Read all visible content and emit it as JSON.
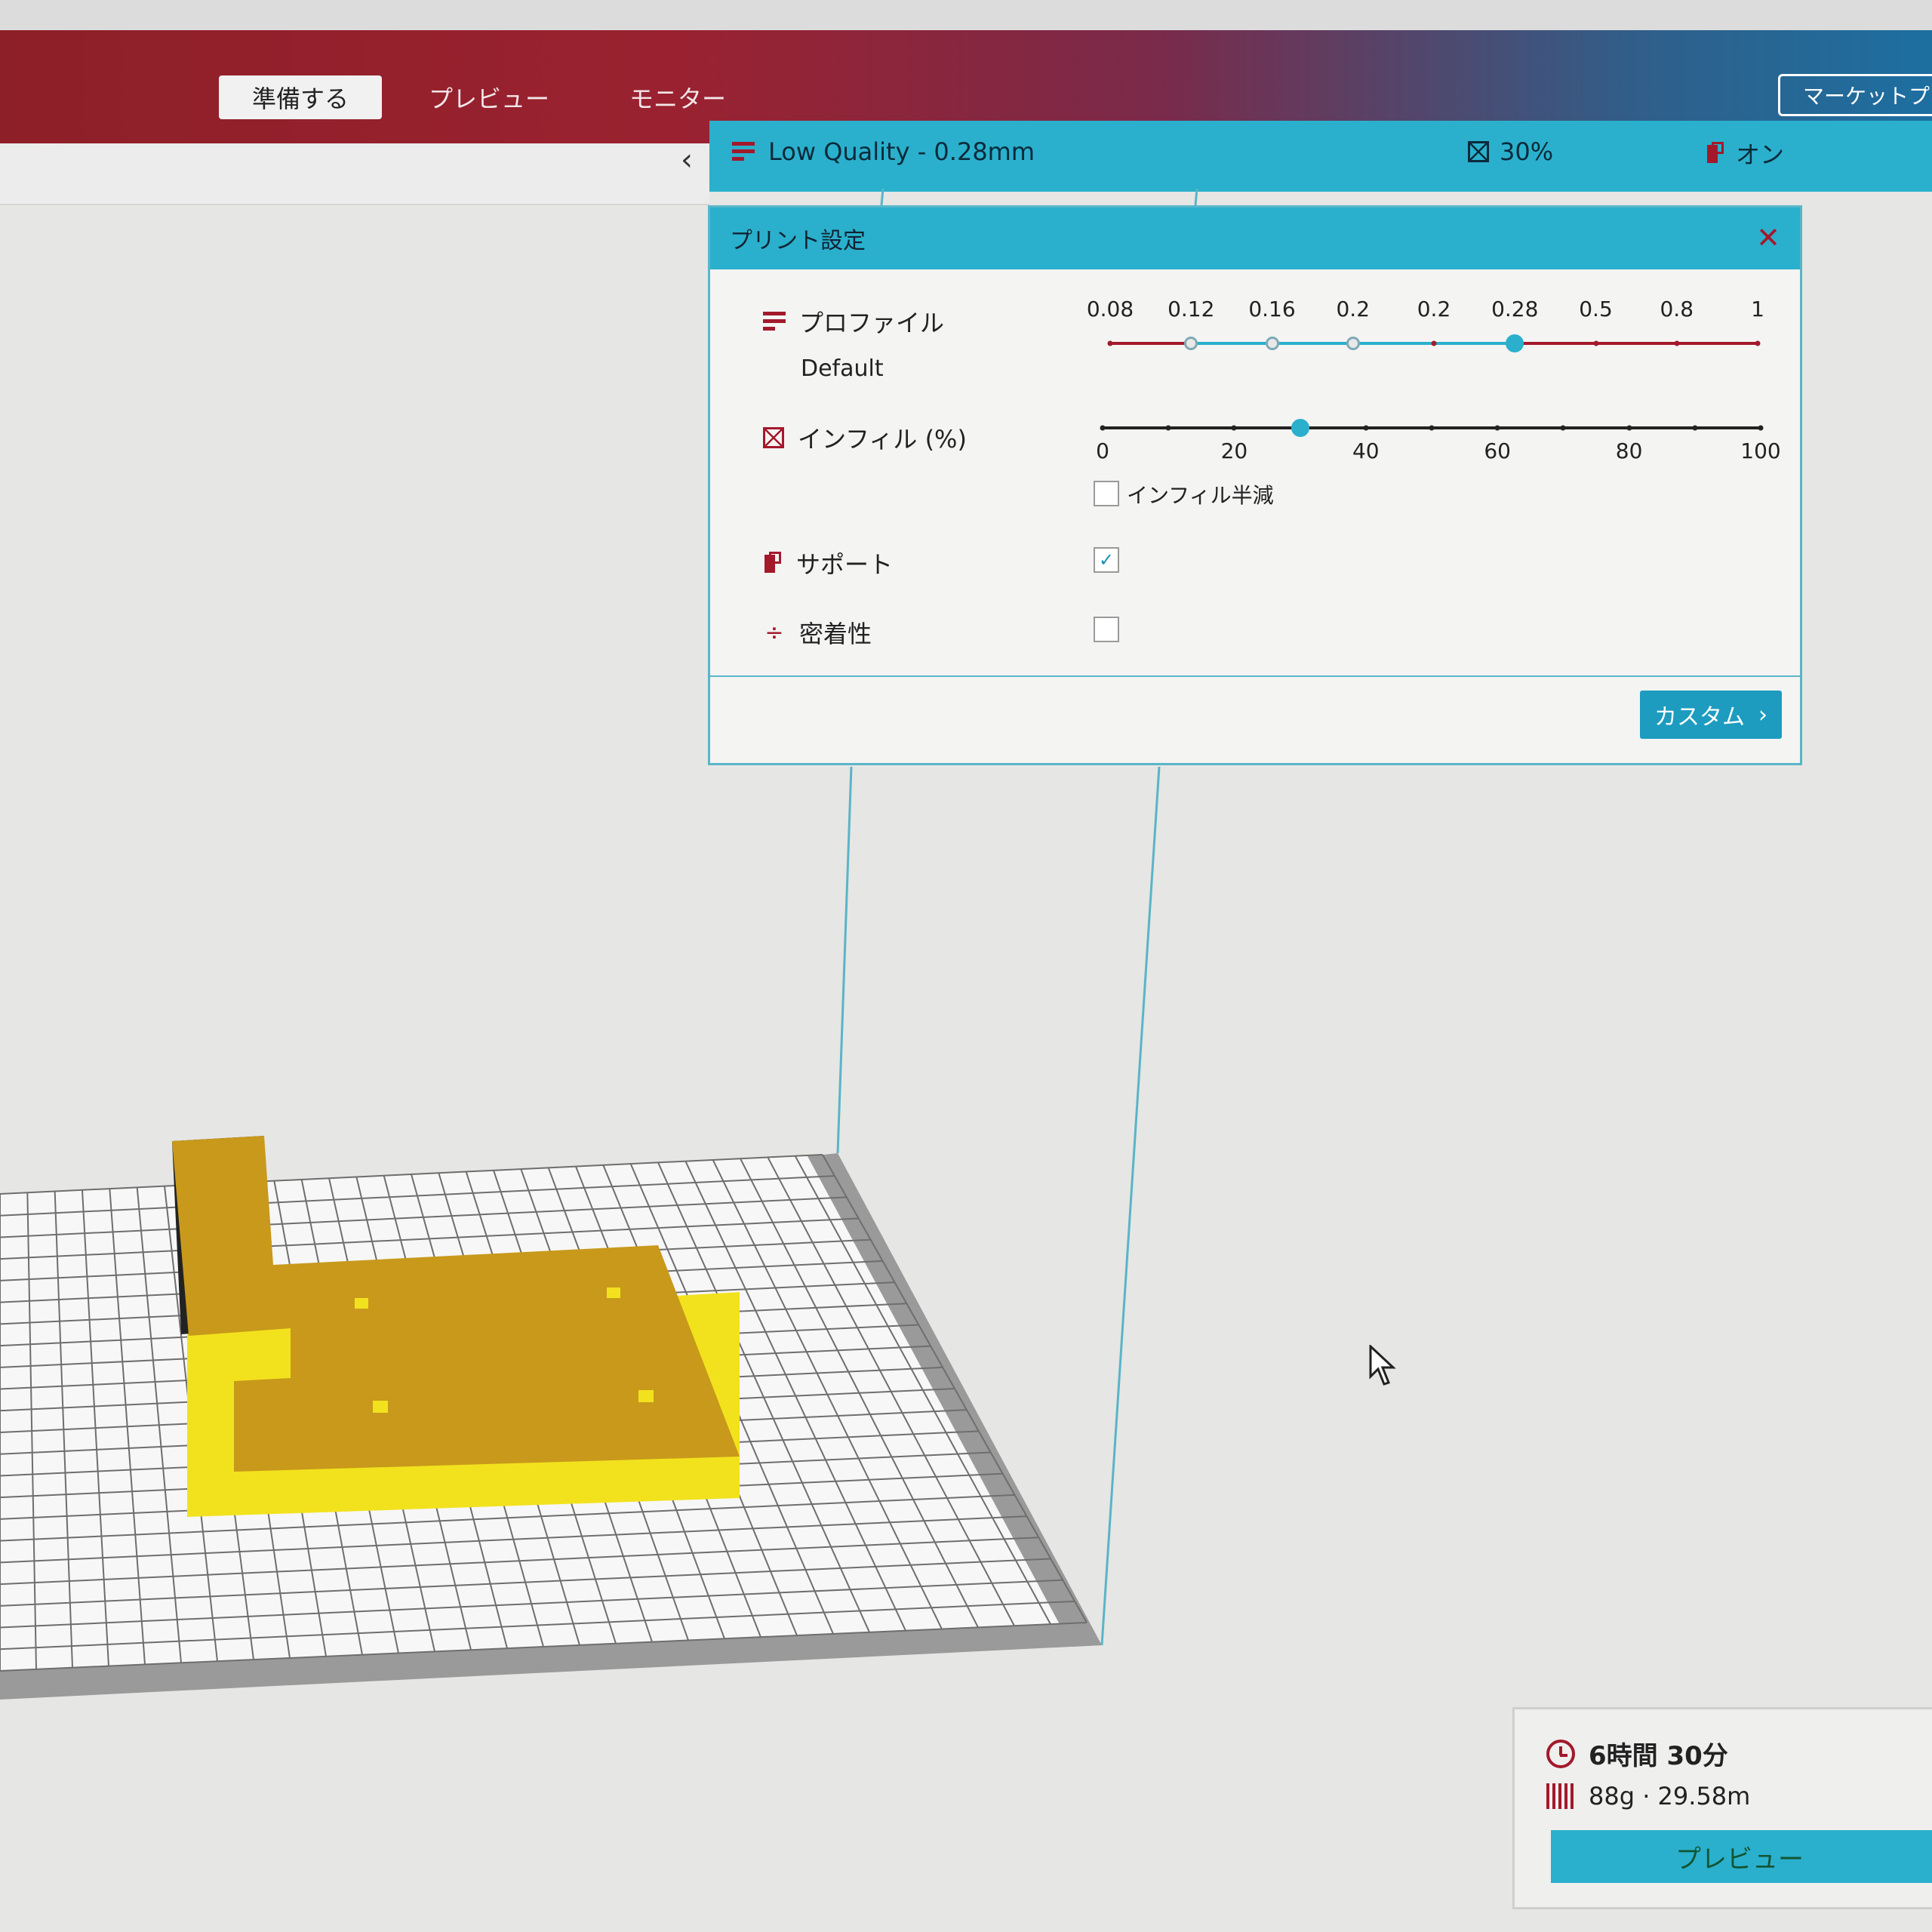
{
  "tabs": [
    {
      "label": "準備する",
      "active": true
    },
    {
      "label": "プレビュー",
      "active": false
    },
    {
      "label": "モニター",
      "active": false
    }
  ],
  "marketplace_label": "マーケットプ",
  "collapse_icon": "chevron-left-icon",
  "quality_bar": {
    "profile": "Low Quality - 0.28mm",
    "infill": "30%",
    "support": "オン"
  },
  "dialog": {
    "title": "プリント設定",
    "close_icon": "close-icon",
    "profile": {
      "label": "プロファイル",
      "value": "Default",
      "ticks": [
        "0.08",
        "0.12",
        "0.16",
        "0.2",
        "0.2",
        "0.28",
        "0.5",
        "0.8",
        "1"
      ],
      "selected_index": 5
    },
    "infill": {
      "label": "インフィル (%)",
      "ticks": [
        "0",
        "20",
        "40",
        "60",
        "80",
        "100"
      ],
      "value_percent": 30,
      "gradual_label": "インフィル半減",
      "gradual_checked": false
    },
    "support": {
      "label": "サポート",
      "checked": true
    },
    "adhesion": {
      "label": "密着性",
      "checked": false
    },
    "custom_button": "カスタム"
  },
  "summary": {
    "time": "6時間 30分",
    "material": "88g · 29.58m",
    "preview_button": "プレビュー"
  },
  "colors": {
    "header_red": "#8d1f28",
    "accent_cyan": "#2ab0cc",
    "brand_red": "#a3192b",
    "model_yellow": "#f0de1a",
    "model_top": "#c89a1a"
  }
}
